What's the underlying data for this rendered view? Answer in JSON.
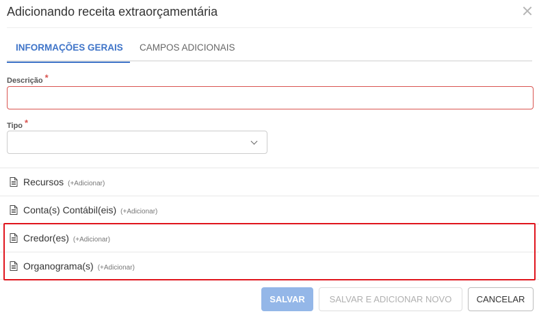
{
  "modal": {
    "title": "Adicionando receita extraorçamentária"
  },
  "tabs": [
    {
      "label": "INFORMAÇÕES GERAIS",
      "active": true
    },
    {
      "label": "CAMPOS ADICIONAIS",
      "active": false
    }
  ],
  "form": {
    "descricao": {
      "label": "Descrição",
      "required_mark": "*",
      "value": ""
    },
    "tipo": {
      "label": "Tipo",
      "required_mark": "*",
      "value": ""
    }
  },
  "sections": [
    {
      "title": "Recursos",
      "action": "(+Adicionar)"
    },
    {
      "title": "Conta(s) Contábil(eis)",
      "action": "(+Adicionar)"
    },
    {
      "title": "Credor(es)",
      "action": "(+Adicionar)"
    },
    {
      "title": "Organograma(s)",
      "action": "(+Adicionar)"
    }
  ],
  "buttons": {
    "save": "SALVAR",
    "save_and_new": "SALVAR E ADICIONAR NOVO",
    "cancel": "CANCELAR"
  },
  "colors": {
    "accent": "#3f74c8",
    "required": "#d9534f",
    "highlight": "#e0141c",
    "save_button": "#94b7e8"
  },
  "icons": {
    "close": "close-icon",
    "section": "document-icon",
    "select": "chevron-down-icon"
  }
}
